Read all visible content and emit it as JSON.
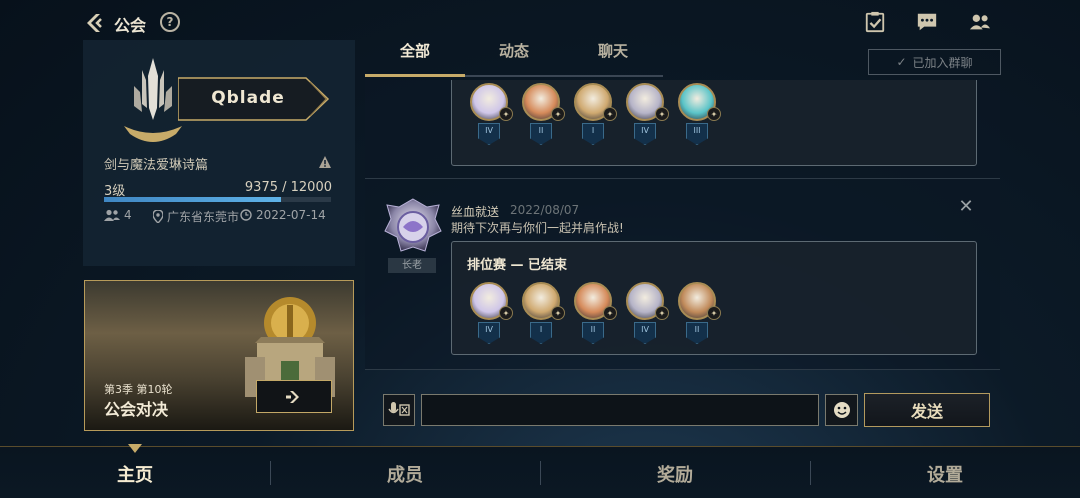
{
  "header": {
    "title": "公会",
    "help_label": "?"
  },
  "guild": {
    "name": "Qblade",
    "subtitle": "剑与魔法爱琳诗篇",
    "level": "3级",
    "exp_text": "9375 / 12000",
    "exp_fraction": 0.78,
    "members": "4",
    "location": "广东省东莞市",
    "date": "2022-07-14"
  },
  "promo": {
    "season": "第3季 第10轮",
    "title": "公会对决",
    "button_icon": "arrow-right-icon"
  },
  "tabs": [
    {
      "label": "全部"
    },
    {
      "label": "动态"
    },
    {
      "label": "聊天"
    }
  ],
  "joined_group": {
    "label": "已加入群聊"
  },
  "post": {
    "author": "丝血就送",
    "date": "2022/08/07",
    "text": "期待下次再与你们一起并肩作战!",
    "role": "长老",
    "match_title": "排位赛 — 已结束"
  },
  "first_match_ranks": [
    "IV",
    "II",
    "I",
    "IV",
    "III"
  ],
  "second_match_ranks": [
    "IV",
    "I",
    "II",
    "IV",
    "II"
  ],
  "input": {
    "placeholder": "",
    "send_label": "发送"
  },
  "nav": [
    {
      "label": "主页"
    },
    {
      "label": "成员"
    },
    {
      "label": "奖励"
    },
    {
      "label": "设置"
    }
  ],
  "colors": {
    "accent_gold": "#c7ab69",
    "exp_blue": "#4b9bd6",
    "background": "#0c1a27"
  }
}
